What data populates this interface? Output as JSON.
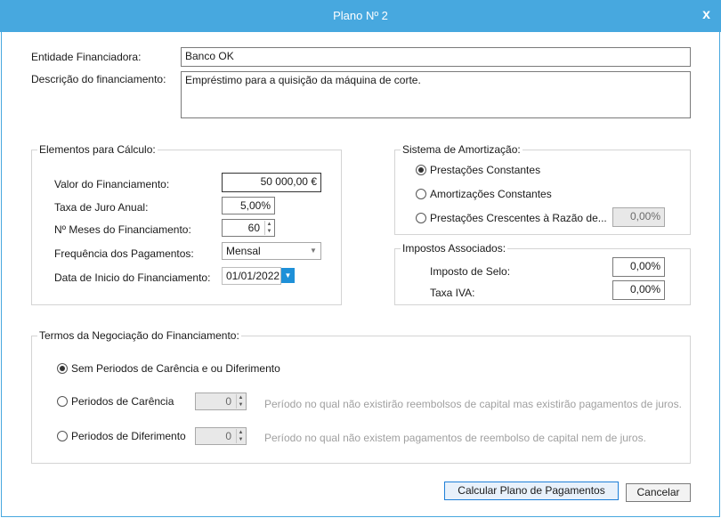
{
  "window": {
    "title": "Plano Nº 2",
    "close_glyph": "x"
  },
  "entity": {
    "label": "Entidade Financiadora:",
    "value": "Banco OK"
  },
  "description": {
    "label": "Descrição do financiamento:",
    "value": "Empréstimo para a quisição da máquina de corte."
  },
  "calc": {
    "legend": "Elementos para Cálculo:",
    "amount_label": "Valor do Financiamento:",
    "amount_value": "50 000,00 €",
    "rate_label": "Taxa de Juro Anual:",
    "rate_value": "5,00%",
    "months_label": "Nº Meses do Financiamento:",
    "months_value": "60",
    "frequency_label": "Frequência dos Pagamentos:",
    "frequency_value": "Mensal",
    "start_label": "Data de Inicio do Financiamento:",
    "start_value": "01/01/2022"
  },
  "amortization": {
    "legend": "Sistema de Amortização:",
    "option1": "Prestações Constantes",
    "option2": "Amortizações Constantes",
    "option3": "Prestações Crescentes à Razão de...",
    "option3_value": "0,00%",
    "selected": "option1"
  },
  "taxes": {
    "legend": "Impostos Associados:",
    "stamp_label": "Imposto de Selo:",
    "stamp_value": "0,00%",
    "vat_label": "Taxa IVA:",
    "vat_value": "0,00%"
  },
  "terms": {
    "legend": "Termos da Negociação do Financiamento:",
    "option1": "Sem Periodos de Carência e ou Diferimento",
    "option2": "Periodos de Carência",
    "option2_value": "0",
    "option2_hint": "Período no qual não existirão reembolsos de capital mas existirão pagamentos de juros.",
    "option3": "Periodos de Diferimento",
    "option3_value": "0",
    "option3_hint": "Período no qual não existem pagamentos de reembolso de capital nem de juros.",
    "selected": "option1"
  },
  "buttons": {
    "calculate": "Calcular Plano de Pagamentos",
    "cancel": "Cancelar"
  }
}
